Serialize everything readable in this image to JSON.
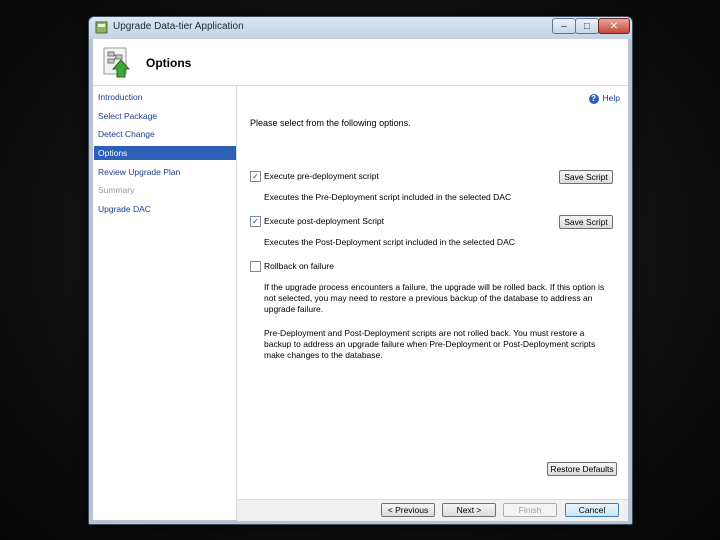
{
  "window": {
    "title": "Upgrade Data-tier Application",
    "buttons": {
      "minimize": "–",
      "maximize": "□",
      "close": "✕"
    }
  },
  "header": {
    "title": "Options",
    "icon": "upgrade-package-icon"
  },
  "nav": {
    "items": [
      {
        "label": "Introduction",
        "state": "link"
      },
      {
        "label": "Select Package",
        "state": "link"
      },
      {
        "label": "Detect Change",
        "state": "link"
      },
      {
        "label": "Options",
        "state": "active"
      },
      {
        "label": "Review Upgrade Plan",
        "state": "link"
      },
      {
        "label": "Summary",
        "state": "disabled"
      },
      {
        "label": "Upgrade DAC",
        "state": "link"
      }
    ]
  },
  "main": {
    "help_label": "Help",
    "prompt": "Please select from the following options.",
    "pre_deploy": {
      "checked": true,
      "label": "Execute pre-deployment script",
      "description": "Executes the Pre-Deployment script included in the selected DAC",
      "button": "Save Script"
    },
    "post_deploy": {
      "checked": true,
      "label": "Execute post-deployment Script",
      "description": "Executes the Post-Deployment script included in the selected DAC",
      "button": "Save Script"
    },
    "rollback": {
      "checked": false,
      "label": "Rollback on failure",
      "description1": "If the upgrade process encounters a failure, the upgrade will be rolled back. If this option is not selected, you may need to restore a previous backup of the database to address an upgrade failure.",
      "description2": "Pre-Deployment and Post-Deployment scripts are not rolled back. You must restore a backup to address an upgrade failure when Pre-Deployment or Post-Deployment scripts make changes to the database."
    },
    "restore_defaults": "Restore Defaults"
  },
  "footer": {
    "previous": "< Previous",
    "next": "Next >",
    "finish": "Finish",
    "cancel": "Cancel"
  }
}
